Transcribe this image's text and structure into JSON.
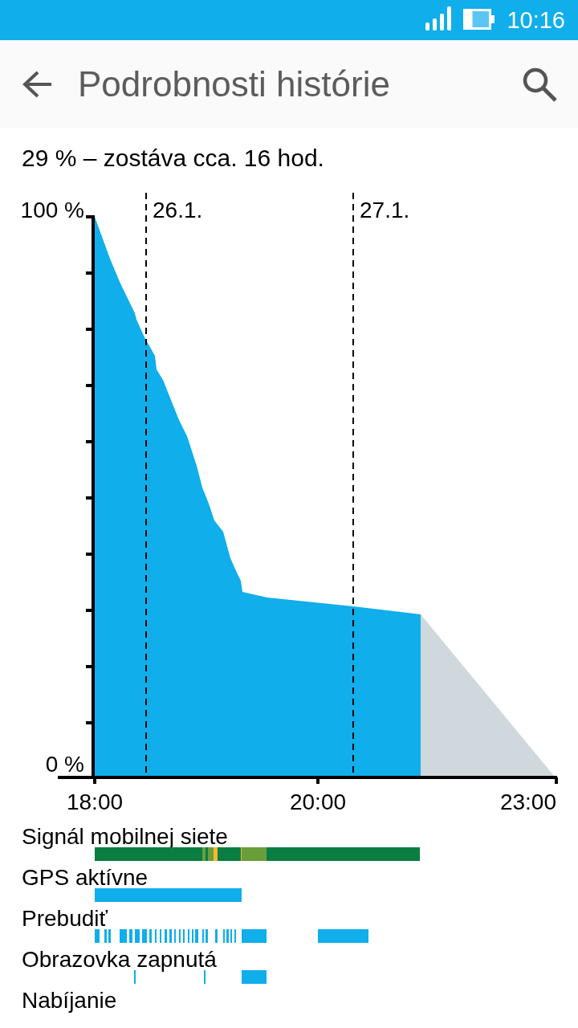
{
  "status_bar": {
    "time": "10:16"
  },
  "app_bar": {
    "title": "Podrobnosti histórie"
  },
  "summary": "29 % – zostáva cca. 16 hod.",
  "battery_chart": {
    "y_labels": [
      "100 %",
      "0 %"
    ],
    "date_markers": [
      "26.1.",
      "27.1."
    ],
    "time_labels": [
      "18:00",
      "20:00",
      "23:00"
    ]
  },
  "timelines": [
    {
      "label": "Signál mobilnej siete",
      "kind": "signal"
    },
    {
      "label": "GPS aktívne",
      "kind": "gps"
    },
    {
      "label": "Prebudiť",
      "kind": "wake"
    },
    {
      "label": "Obrazovka zapnutá",
      "kind": "screen"
    },
    {
      "label": "Nabíjanie",
      "kind": "charging"
    }
  ]
}
